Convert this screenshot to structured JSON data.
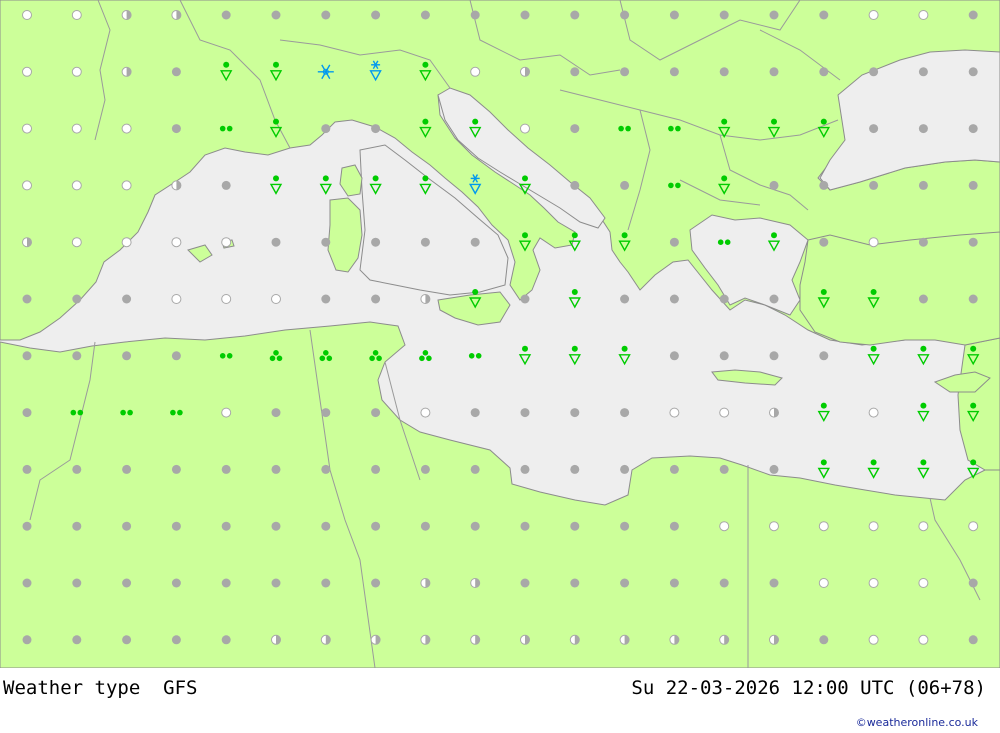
{
  "footer": {
    "product": "Weather type",
    "model": "GFS",
    "valid_time": "Su 22-03-2026 12:00 UTC (06+78)",
    "credit": "©weatheronline.co.uk"
  },
  "colors": {
    "land": "#ccff99",
    "sea": "#eeeeee",
    "border": "#9a9a9a",
    "coast": "#8c8c8c",
    "dry": "#a8a8a8",
    "rain": "#00cc00",
    "snow": "#0099ee"
  },
  "icons": {
    "legend": [
      "sunny-icon",
      "partly-cloudy-icon",
      "overcast-icon",
      "drizzle-icon",
      "rain-icon",
      "rain-shower-icon",
      "snow-icon",
      "snow-shower-icon"
    ]
  },
  "grid": {
    "columns": 20,
    "rows": 12,
    "codes": [
      "..ppooooooooooooocco",
      "sspoRRXZR.pooooooooo",
      "sssoDRooRRcoDDRRRooo",
      "ssspoRRRRZRooDRooooo",
      "pssssoooooRRRoDRocoo",
      "ooosssoopRoRooooRRoo",
      "ooooDTTTTDRRRooooRRR",
      "oDDDsooosoooosspRsRR",
      "ooooooooooooooooRRRR",
      "oooooooooooooossssss",
      "ooooooooppoooooossso",
      "oooooppppppppppposso"
    ]
  }
}
